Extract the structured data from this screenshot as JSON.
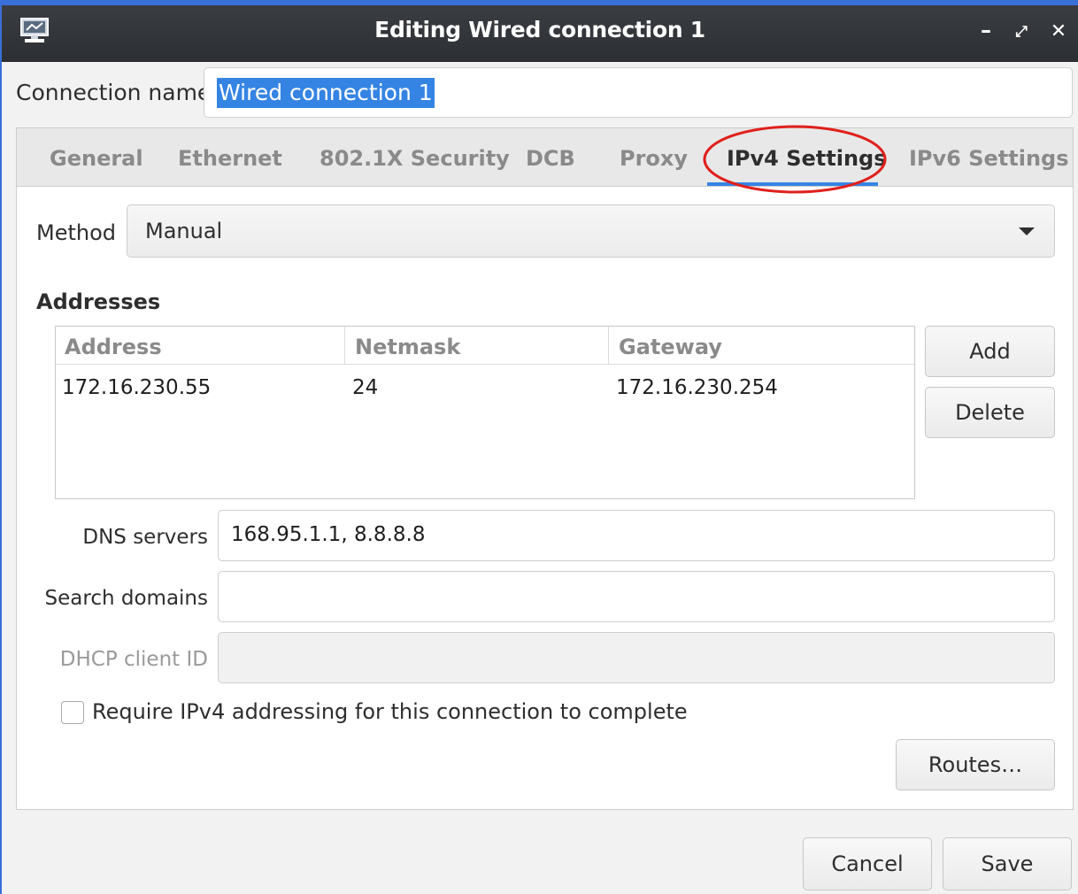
{
  "window": {
    "title": "Editing Wired connection 1",
    "app_icon": "network-connection-icon",
    "controls": {
      "minimize": "–",
      "maximize": "⤢",
      "close": "✕"
    }
  },
  "connection": {
    "label": "Connection name",
    "value": "Wired connection 1"
  },
  "tabs": [
    {
      "label": "General"
    },
    {
      "label": "Ethernet"
    },
    {
      "label": "802.1X Security"
    },
    {
      "label": "DCB"
    },
    {
      "label": "Proxy"
    },
    {
      "label": "IPv4 Settings"
    },
    {
      "label": "IPv6 Settings"
    }
  ],
  "active_tab": "IPv4 Settings",
  "annotation": {
    "color": "#e0201c"
  },
  "ipv4": {
    "method_label": "Method",
    "method_value": "Manual",
    "addresses_heading": "Addresses",
    "columns": {
      "address": "Address",
      "netmask": "Netmask",
      "gateway": "Gateway"
    },
    "rows": [
      {
        "address": "172.16.230.55",
        "netmask": "24",
        "gateway": "172.16.230.254"
      }
    ],
    "add_label": "Add",
    "delete_label": "Delete",
    "dns_label": "DNS servers",
    "dns_value": "168.95.1.1, 8.8.8.8",
    "search_label": "Search domains",
    "search_value": "",
    "dhcp_label": "DHCP client ID",
    "dhcp_value": "",
    "require_label": "Require IPv4 addressing for this connection to complete",
    "require_checked": false,
    "routes_label": "Routes…"
  },
  "footer": {
    "cancel_label": "Cancel",
    "save_label": "Save"
  },
  "colors": {
    "accent": "#3584e4",
    "titlebar": "#2f3236",
    "window_border": "#3b6fd8"
  }
}
